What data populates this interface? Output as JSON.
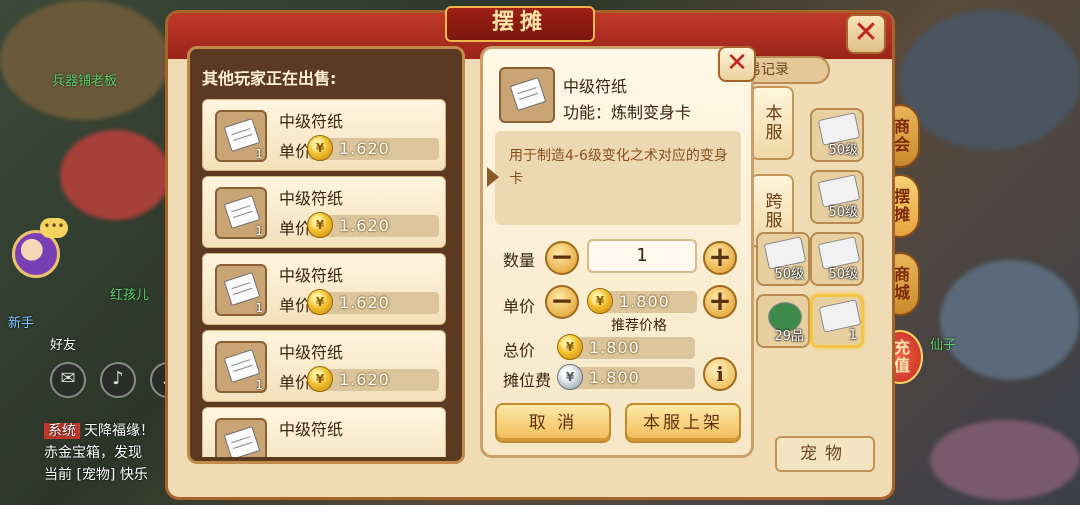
{
  "background": {
    "names": [
      "兵器铺老板",
      "新手",
      "好友",
      "红孩儿",
      "仙子"
    ],
    "chat": {
      "tag": "系统",
      "line1": "天降福缘！",
      "line2": "赤金宝箱，发现",
      "line3": "当前 [宠物] 快乐"
    }
  },
  "side_tabs": [
    "商会",
    "摆摊",
    "商城",
    "充值"
  ],
  "stall": {
    "title": "摆摊",
    "close_icon": "✕",
    "trade_record": "易记录",
    "server_tabs": [
      "本服",
      "跨服"
    ],
    "grid": [
      {
        "level": "50级"
      },
      {
        "level": "50级"
      },
      {
        "level": "50级"
      },
      {
        "level": "50级"
      },
      {
        "level": "50级"
      },
      {
        "level": "29品"
      },
      {
        "level": "1"
      }
    ],
    "pet_tab": "宠物"
  },
  "list": {
    "title": "其他玩家正在出售:",
    "price_label": "单价",
    "items": [
      {
        "name": "中级符纸",
        "count": "1",
        "price": "1.620"
      },
      {
        "name": "中级符纸",
        "count": "1",
        "price": "1.620"
      },
      {
        "name": "中级符纸",
        "count": "1",
        "price": "1.620"
      },
      {
        "name": "中级符纸",
        "count": "1",
        "price": "1.620"
      },
      {
        "name": "中级符纸",
        "count": "",
        "price": ""
      }
    ]
  },
  "dialog": {
    "close_icon": "✕",
    "item_name": "中级符纸",
    "function": "功能：炼制变身卡",
    "description": "用于制造4-6级变化之术对应的变身卡",
    "quantity_label": "数量",
    "quantity_value": "1",
    "price_label": "单价",
    "price_value": "1.800",
    "suggest_label": "推荐价格",
    "total_label": "总价",
    "total_value": "1.800",
    "fee_label": "摊位费",
    "fee_value": "1.800",
    "minus_icon": "−",
    "plus_icon": "+",
    "info_icon": "i",
    "cancel_label": "取 消",
    "confirm_label": "本服上架"
  },
  "colors": {
    "accent_red": "#c0392b",
    "panel_brown": "#5c3a22",
    "gold": "#f2c12e"
  }
}
